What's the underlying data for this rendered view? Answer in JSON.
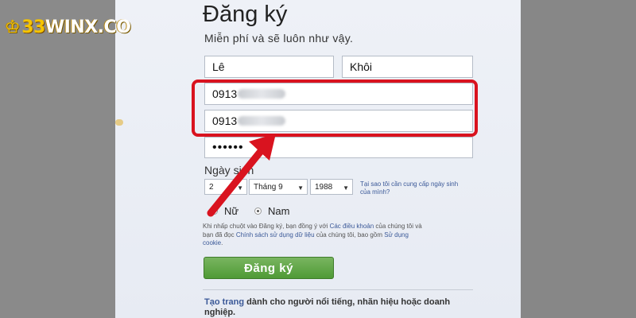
{
  "brand": {
    "logo_mark": "♔",
    "logo_num": "33",
    "logo_text": "WINX.CO"
  },
  "form": {
    "title": "Đăng ký",
    "subtitle": "Miễn phí và sẽ luôn như vậy.",
    "first_name_value": "Lê",
    "last_name_value": "Khôi",
    "phone_value": "0913",
    "phone_confirm_value": "0913",
    "password_value": "••••••",
    "birthday_label": "Ngày sinh",
    "day_value": "2",
    "month_value": "Tháng 9",
    "year_value": "1988",
    "why_birthday": "Tại sao tôi cần cung cấp ngày sinh của mình?",
    "gender_female": "Nữ",
    "gender_male": "Nam",
    "terms_prefix": "Khi nhấp chuột vào Đăng ký, bạn đồng ý với ",
    "terms_link": "Các điều khoản",
    "terms_mid": " của chúng tôi và bạn đã đọc ",
    "data_policy_link": "Chính sách sử dụng dữ liệu",
    "terms_mid2": " của chúng tôi, bao gồm ",
    "cookie_link": "Sử dụng cookie",
    "terms_end": ".",
    "submit_label": "Đăng ký",
    "footer_link": "Tạo trang",
    "footer_text": " dành cho người nổi tiếng, nhãn hiệu hoặc doanh nghiệp."
  },
  "colors": {
    "highlight": "#d9131f",
    "arrow": "#d9131f",
    "button": "#5ea544",
    "link": "#3b5998"
  }
}
